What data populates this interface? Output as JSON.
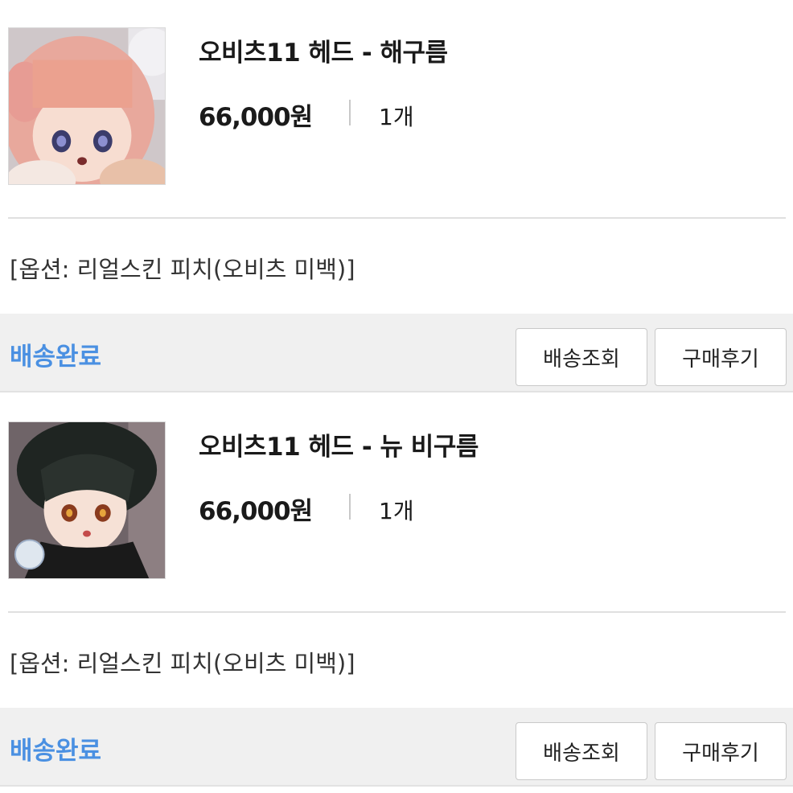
{
  "orders": [
    {
      "product_name": "오비츠11 헤드 - 해구름",
      "price": "66,000원",
      "quantity": "1개",
      "option": "[옵션: 리얼스킨 피치(오비츠 미백)]",
      "status": "배송완료",
      "track_label": "배송조회",
      "review_label": "구매후기"
    },
    {
      "product_name": "오비츠11 헤드 - 뉴 비구름",
      "price": "66,000원",
      "quantity": "1개",
      "option": "[옵션: 리얼스킨 피치(오비츠 미백)]",
      "status": "배송완료",
      "track_label": "배송조회",
      "review_label": "구매후기"
    }
  ],
  "colors": {
    "status_accent": "#4a90e2",
    "footer_bg": "#f0f0f0"
  }
}
